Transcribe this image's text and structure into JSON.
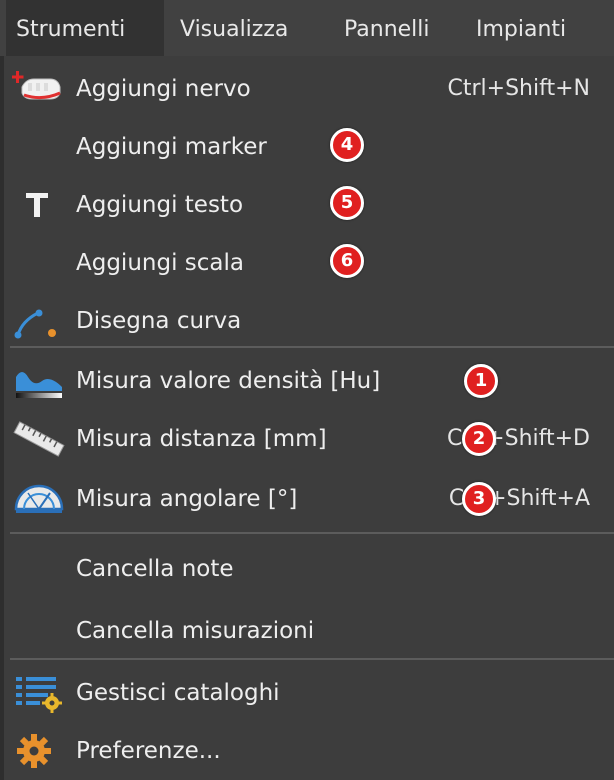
{
  "menubar": {
    "items": [
      {
        "label": "Strumenti",
        "active": true
      },
      {
        "label": "Visualizza"
      },
      {
        "label": "Pannelli"
      },
      {
        "label": "Impianti"
      }
    ]
  },
  "menu": {
    "items": [
      {
        "label": "Aggiungi nervo",
        "shortcut": "Ctrl+Shift+N",
        "icon": "add-nerve-icon"
      },
      {
        "label": "Aggiungi marker",
        "badge": "4"
      },
      {
        "label": "Aggiungi testo",
        "icon": "text-icon",
        "badge": "5"
      },
      {
        "label": "Aggiungi scala",
        "badge": "6"
      },
      {
        "label": "Disegna curva",
        "icon": "draw-curve-icon"
      },
      {
        "label": "Misura valore densità [Hu]",
        "icon": "density-icon",
        "badge": "1"
      },
      {
        "label": "Misura distanza [mm]",
        "shortcut": "Ctrl+Shift+D",
        "icon": "ruler-icon",
        "badge": "2"
      },
      {
        "label": "Misura angolare [°]",
        "shortcut": "Ctrl+Shift+A",
        "icon": "protractor-icon",
        "badge": "3"
      },
      {
        "label": "Cancella note"
      },
      {
        "label": "Cancella misurazioni"
      },
      {
        "label": "Gestisci cataloghi",
        "icon": "catalog-settings-icon"
      },
      {
        "label": "Preferenze...",
        "icon": "gear-icon"
      }
    ]
  },
  "colors": {
    "background": "#3d3d3d",
    "menubar": "#414141",
    "active_menubar": "#323232",
    "text": "#eeeeee",
    "badge": "#e02020",
    "icon_blue": "#3a8fd8",
    "icon_orange": "#e8912c"
  }
}
